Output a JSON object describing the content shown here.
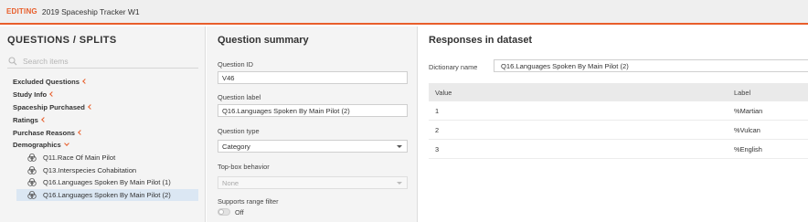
{
  "topbar": {
    "mode": "EDITING",
    "title": "2019 Spaceship Tracker W1"
  },
  "left": {
    "title": "QUESTIONS / SPLITS",
    "search_placeholder": "Search items",
    "groups": [
      {
        "label": "Excluded Questions",
        "expanded": false
      },
      {
        "label": "Study Info",
        "expanded": false
      },
      {
        "label": "Spaceship Purchased",
        "expanded": false
      },
      {
        "label": "Ratings",
        "expanded": false
      },
      {
        "label": "Purchase Reasons",
        "expanded": false
      },
      {
        "label": "Demographics",
        "expanded": true
      }
    ],
    "demographics_items": [
      {
        "label": "Q11.Race Of Main Pilot",
        "icon": "venn-icon"
      },
      {
        "label": "Q13.Interspecies Cohabitation",
        "icon": "venn-icon"
      },
      {
        "label": "Q16.Languages Spoken By Main Pilot (1)",
        "icon": "venn-icon"
      },
      {
        "label": "Q16.Languages Spoken By Main Pilot (2)",
        "icon": "venn-icon",
        "selected": true
      }
    ]
  },
  "summary": {
    "title": "Question summary",
    "question_id_label": "Question ID",
    "question_id": "V46",
    "question_label_label": "Question label",
    "question_label": "Q16.Languages Spoken By Main Pilot (2)",
    "question_type_label": "Question type",
    "question_type": "Category",
    "topbox_label": "Top-box behavior",
    "topbox_value": "None",
    "range_filter_label": "Supports range filter",
    "range_filter_state": "Off"
  },
  "responses": {
    "title": "Responses in dataset",
    "dictionary_label": "Dictionary name",
    "dictionary_name": "Q16.Languages Spoken By Main Pilot (2)",
    "columns": [
      "Value",
      "Label"
    ],
    "rows": [
      {
        "value": "1",
        "label": "%Martian"
      },
      {
        "value": "2",
        "label": "%Vulcan"
      },
      {
        "value": "3",
        "label": "%English"
      }
    ]
  },
  "colors": {
    "accent": "#e85e2b",
    "selected_row": "#dbe7f3",
    "panel_bg": "#f4f4f4"
  }
}
